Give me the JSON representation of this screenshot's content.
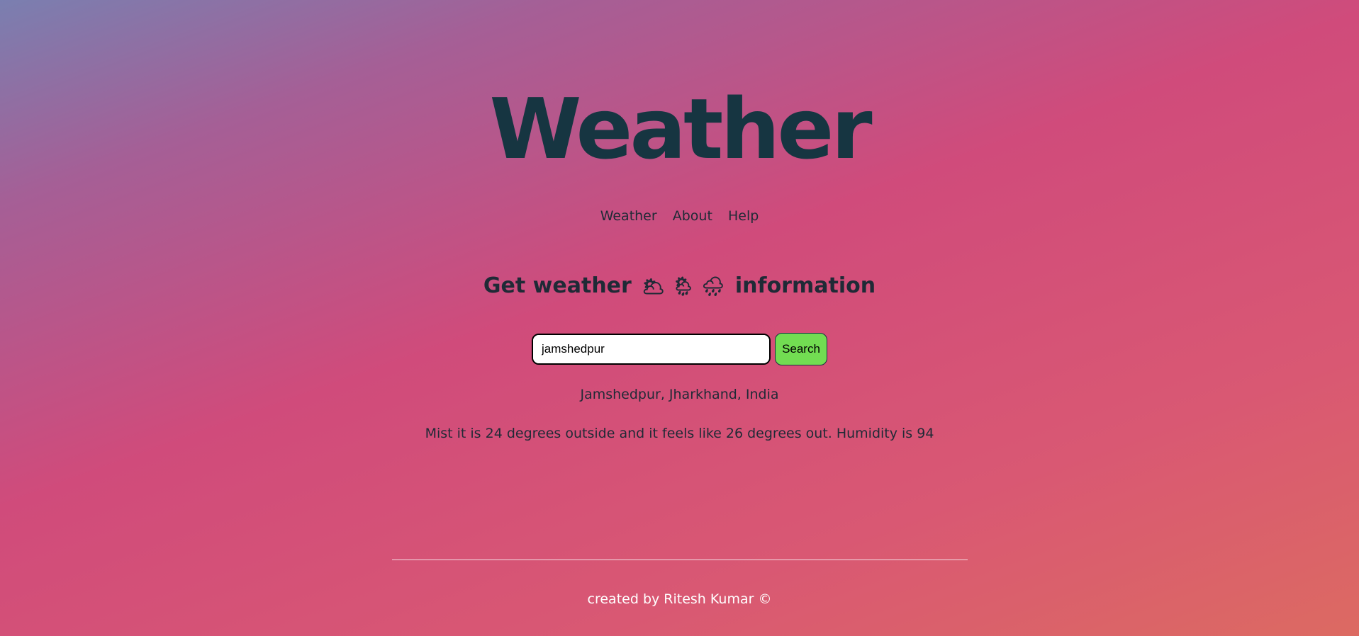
{
  "header": {
    "title": "Weather"
  },
  "nav": {
    "items": [
      {
        "label": "Weather"
      },
      {
        "label": "About"
      },
      {
        "label": "Help"
      }
    ]
  },
  "main": {
    "heading_prefix": "Get weather",
    "heading_icons": "🌥 🌦 🌧",
    "heading_suffix": "information",
    "search": {
      "value": "jamshedpur",
      "button_label": "Search"
    },
    "location": "Jamshedpur, Jharkhand, India",
    "forecast": "Mist it is 24 degrees outside and it feels like 26 degrees out. Humidity is 94"
  },
  "footer": {
    "text": "created by Ritesh Kumar ©"
  },
  "colors": {
    "title": "#163541",
    "search_button": "#72dd52",
    "footer_text": "#ffffff"
  },
  "icons": [
    "sun-behind-cloud-icon",
    "sun-behind-rain-cloud-icon",
    "rain-cloud-icon"
  ]
}
